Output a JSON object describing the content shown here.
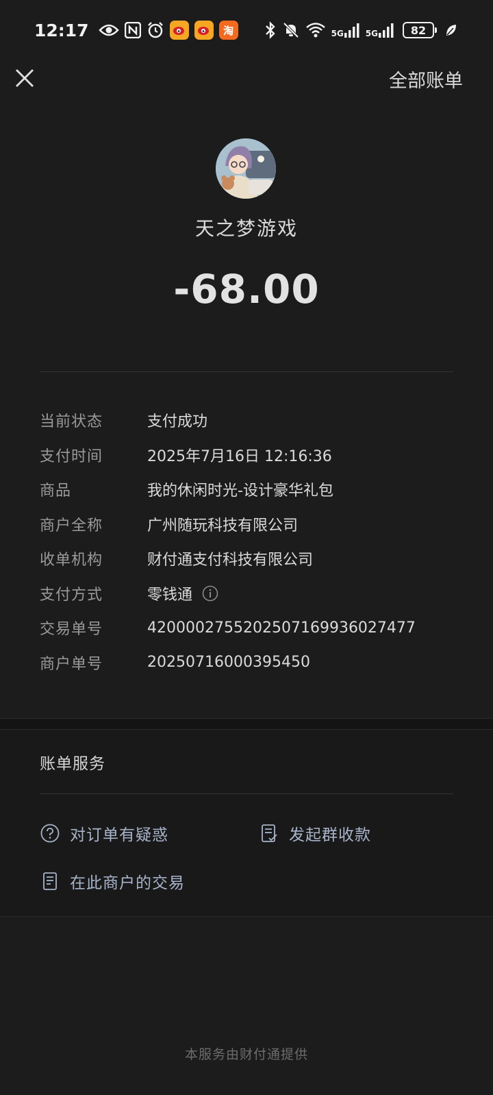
{
  "status_bar": {
    "time": "12:17",
    "battery": "82",
    "taobao_glyph": "淘",
    "net1": "5G",
    "net2": "5G",
    "left_icons": [
      "eye-icon",
      "nfc-icon",
      "alarm-icon",
      "weibo-icon",
      "weibo-icon",
      "taobao-icon"
    ],
    "right_icons": [
      "bluetooth-icon",
      "mute-icon",
      "wifi-icon",
      "signal-icon",
      "signal-icon",
      "leaf-icon"
    ]
  },
  "header": {
    "close_icon": "close-icon",
    "all_bills": "全部账单"
  },
  "merchant": {
    "name": "天之梦游戏",
    "amount": "-68.00"
  },
  "details": [
    {
      "label": "当前状态",
      "value": "支付成功"
    },
    {
      "label": "支付时间",
      "value": "2025年7月16日 12:16:36"
    },
    {
      "label": "商品",
      "value": "我的休闲时光-设计豪华礼包"
    },
    {
      "label": "商户全称",
      "value": "广州随玩科技有限公司"
    },
    {
      "label": "收单机构",
      "value": "财付通支付科技有限公司"
    },
    {
      "label": "支付方式",
      "value": "零钱通"
    },
    {
      "label": "交易单号",
      "value": "4200002755202507169936027477"
    },
    {
      "label": "商户单号",
      "value": "20250716000395450"
    }
  ],
  "services": {
    "title": "账单服务",
    "doubt": "对订单有疑惑",
    "group_collect": "发起群收款",
    "merchant_trades": "在此商户的交易"
  },
  "footer": "本服务由财付通提供",
  "colors": {
    "background": "#1c1c1c",
    "service_link": "#a7b4c9",
    "label": "#9a9a9a"
  }
}
